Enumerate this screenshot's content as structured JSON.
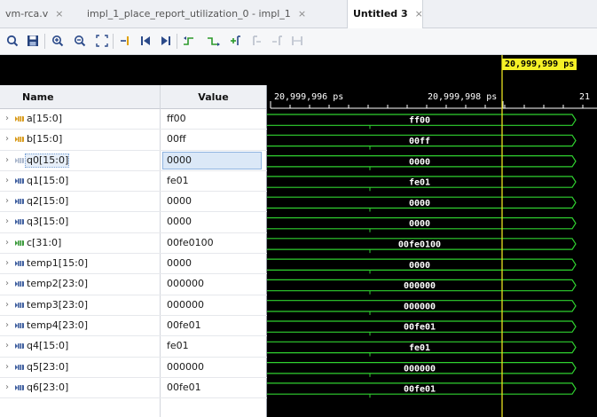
{
  "tabs": [
    {
      "label": "vm-rca.v",
      "close": "×",
      "active": false
    },
    {
      "label": "impl_1_place_report_utilization_0 - impl_1",
      "close": "×",
      "active": false
    },
    {
      "label": "Untitled 3",
      "close": "×",
      "active": true
    }
  ],
  "toolbar": {
    "icons": [
      "search-icon",
      "save-icon",
      "zoom-in-icon",
      "zoom-out-icon",
      "zoom-fit-icon",
      "go-to-cursor-icon",
      "go-to-start-icon",
      "go-to-end-icon",
      "previous-transition-icon",
      "next-transition-icon",
      "add-marker-icon",
      "previous-marker-icon",
      "next-marker-icon",
      "swap-cursors-icon"
    ]
  },
  "columns": {
    "name": "Name",
    "value": "Value"
  },
  "signals": [
    {
      "name": "a[15:0]",
      "value": "ff00",
      "wave": "ff00",
      "icon": "bus-input-icon"
    },
    {
      "name": "b[15:0]",
      "value": "00ff",
      "wave": "00ff",
      "icon": "bus-input-icon"
    },
    {
      "name": "q0[15:0]",
      "value": "0000",
      "wave": "0000",
      "icon": "bus-disabled-icon",
      "selected": true
    },
    {
      "name": "q1[15:0]",
      "value": "fe01",
      "wave": "fe01",
      "icon": "bus-icon"
    },
    {
      "name": "q2[15:0]",
      "value": "0000",
      "wave": "0000",
      "icon": "bus-icon"
    },
    {
      "name": "q3[15:0]",
      "value": "0000",
      "wave": "0000",
      "icon": "bus-icon"
    },
    {
      "name": "c[31:0]",
      "value": "00fe0100",
      "wave": "00fe0100",
      "icon": "bus-output-icon"
    },
    {
      "name": "temp1[15:0]",
      "value": "0000",
      "wave": "0000",
      "icon": "bus-icon"
    },
    {
      "name": "temp2[23:0]",
      "value": "000000",
      "wave": "000000",
      "icon": "bus-icon"
    },
    {
      "name": "temp3[23:0]",
      "value": "000000",
      "wave": "000000",
      "icon": "bus-icon"
    },
    {
      "name": "temp4[23:0]",
      "value": "00fe01",
      "wave": "00fe01",
      "icon": "bus-icon"
    },
    {
      "name": "q4[15:0]",
      "value": "fe01",
      "wave": "fe01",
      "icon": "bus-icon"
    },
    {
      "name": "q5[23:0]",
      "value": "000000",
      "wave": "000000",
      "icon": "bus-icon"
    },
    {
      "name": "q6[23:0]",
      "value": "00fe01",
      "wave": "00fe01",
      "icon": "bus-icon"
    }
  ],
  "timeline": {
    "cursor_time": "20,999,999 ps",
    "ticks": [
      "20,999,996 ps",
      "20,999,998 ps",
      "21"
    ]
  },
  "colors": {
    "wave": "#2fd12f",
    "cursor": "#e8e020",
    "wave_background": "#000000"
  }
}
